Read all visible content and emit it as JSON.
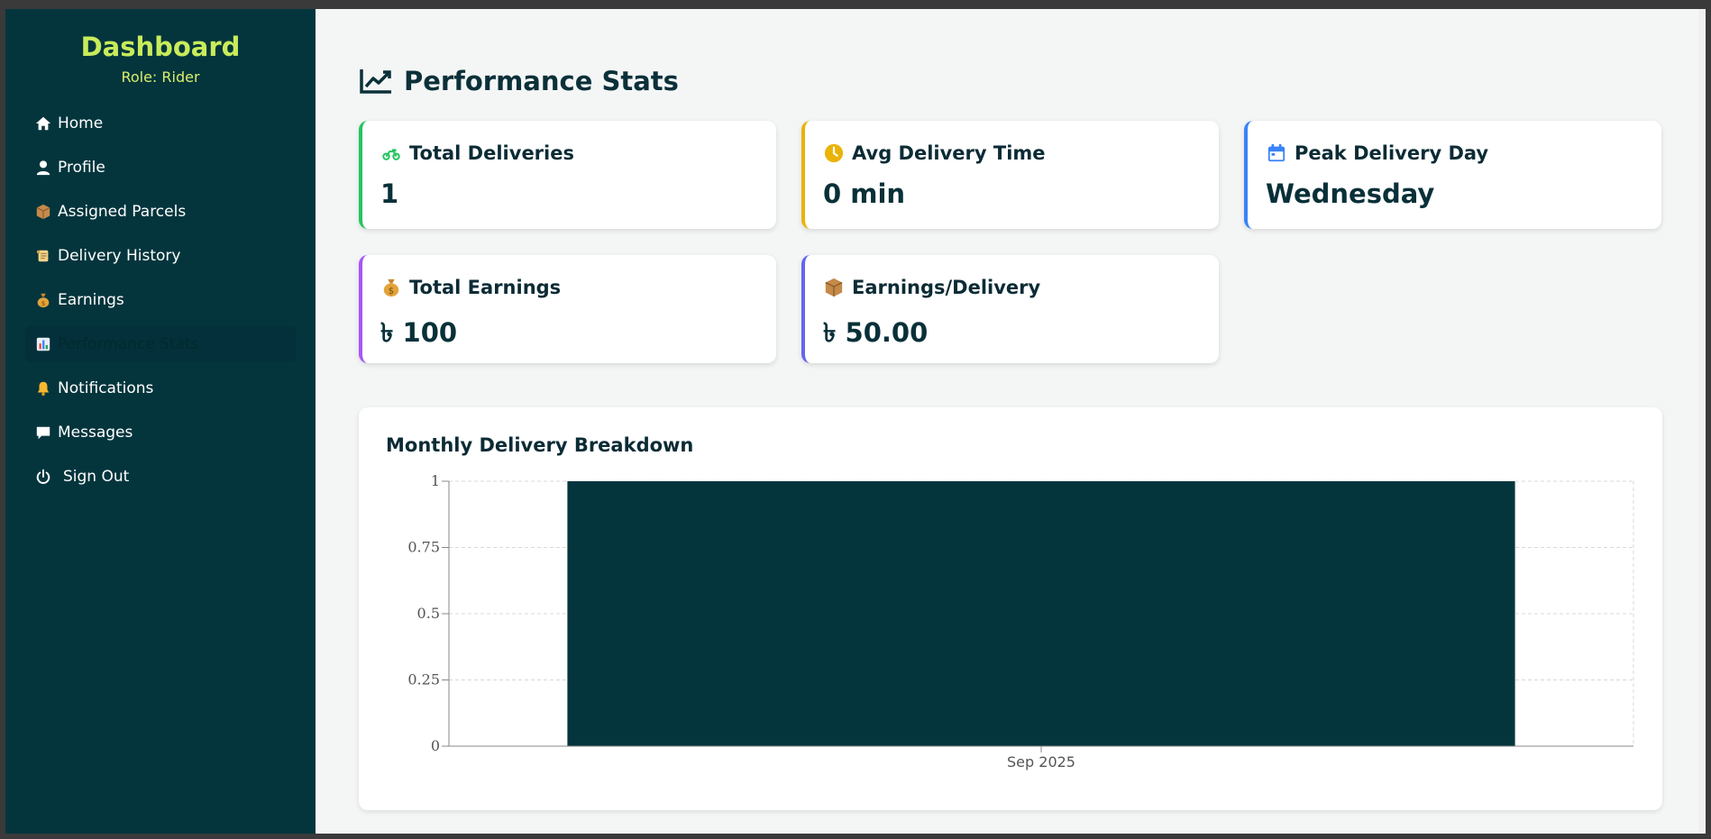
{
  "sidebar": {
    "title": "Dashboard",
    "role": "Role: Rider",
    "items": [
      {
        "label": "Home",
        "icon": "home-icon"
      },
      {
        "label": "Profile",
        "icon": "user-icon"
      },
      {
        "label": "Assigned Parcels",
        "icon": "package-icon"
      },
      {
        "label": "Delivery History",
        "icon": "scroll-icon"
      },
      {
        "label": "Earnings",
        "icon": "money-bag-icon"
      },
      {
        "label": "Performance Stats",
        "icon": "bar-chart-icon",
        "active": true
      },
      {
        "label": "Notifications",
        "icon": "bell-icon"
      },
      {
        "label": "Messages",
        "icon": "message-icon"
      },
      {
        "label": "Sign Out",
        "icon": "power-icon"
      }
    ]
  },
  "header": {
    "title": "Performance Stats",
    "icon": "chart-line-icon"
  },
  "cards": [
    {
      "label": "Total Deliveries",
      "value": "1",
      "icon": "motorcycle-icon",
      "accent": "#22c55e"
    },
    {
      "label": "Avg Delivery Time",
      "value": "0 min",
      "icon": "clock-icon",
      "accent": "#eab308"
    },
    {
      "label": "Peak Delivery Day",
      "value": "Wednesday",
      "icon": "calendar-icon",
      "accent": "#3b82f6"
    },
    {
      "label": "Total Earnings",
      "value": "৳ 100",
      "icon": "money-bag-icon",
      "accent": "#a855f7"
    },
    {
      "label": "Earnings/Delivery",
      "value": "৳ 50.00",
      "icon": "package-icon",
      "accent": "#6366f1"
    }
  ],
  "chart": {
    "title": "Monthly Delivery Breakdown",
    "bar_color": "#04353d"
  },
  "chart_data": {
    "type": "bar",
    "title": "Monthly Delivery Breakdown",
    "categories": [
      "Sep 2025"
    ],
    "values": [
      1
    ],
    "xlabel": "",
    "ylabel": "",
    "ylim": [
      0,
      1
    ],
    "yticks": [
      "0",
      "0.25",
      "0.5",
      "0.75",
      "1"
    ],
    "grid": true
  }
}
